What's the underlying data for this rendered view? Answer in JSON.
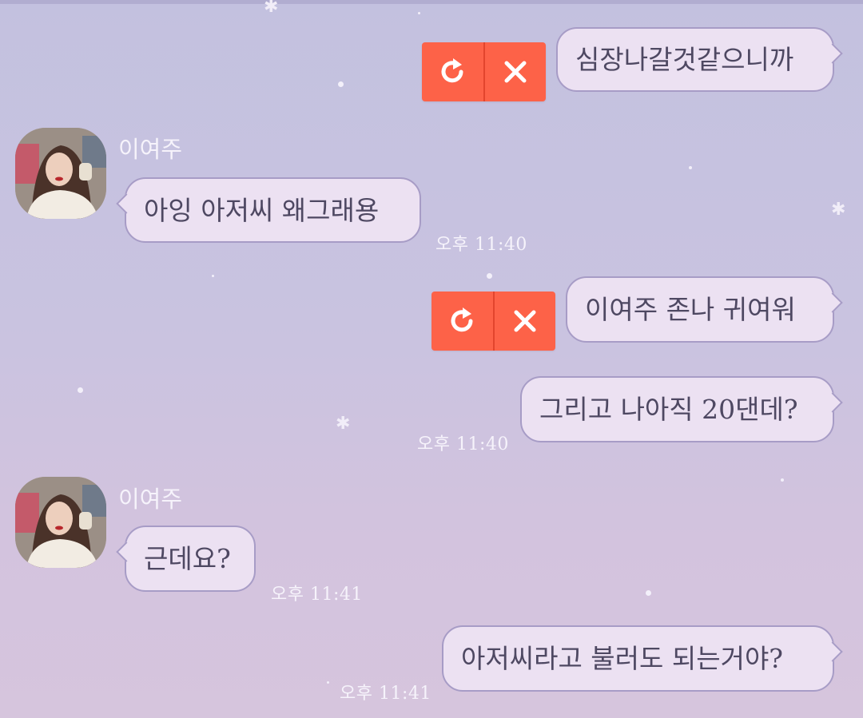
{
  "chat": {
    "contact_name": "이여주",
    "messages": [
      {
        "from": "me",
        "text": "심장나갈것같으니까",
        "status": "failed"
      },
      {
        "from": "them",
        "sender": "이여주",
        "text": "아잉 아저씨 왜그래용",
        "time": "오후 11:40"
      },
      {
        "from": "me",
        "text": "이여주 존나 귀여워",
        "status": "failed"
      },
      {
        "from": "me",
        "text": "그리고 나아직 20댄데?",
        "time": "오후 11:40"
      },
      {
        "from": "them",
        "sender": "이여주",
        "text": "근데요?",
        "time": "오후 11:41"
      },
      {
        "from": "me",
        "text": "아저씨라고 불러도 되는거야?",
        "time": "오후 11:41"
      }
    ]
  },
  "icons": {
    "resend": "resend-icon",
    "delete": "close-icon",
    "avatar": "profile-photo"
  },
  "colors": {
    "background_top": "#c3c1df",
    "background_bottom": "#d6c5dd",
    "bubble": "#ece1f2",
    "bubble_border": "#a79cc6",
    "bubble_text": "#4e4862",
    "failed_accent": "#fd6248",
    "meta_text": "#f6f3fb"
  }
}
